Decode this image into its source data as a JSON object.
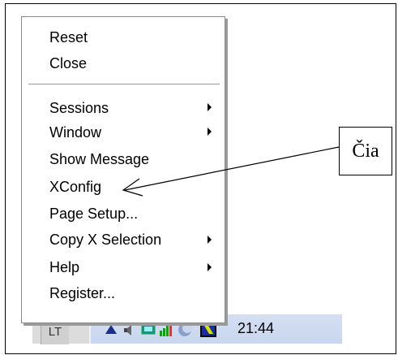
{
  "menu": {
    "items": [
      {
        "label": "Reset",
        "submenu": false
      },
      {
        "label": "Close",
        "submenu": false
      },
      {
        "label": "Sessions",
        "submenu": true
      },
      {
        "label": "Window",
        "submenu": true
      },
      {
        "label": "Show Message",
        "submenu": false
      },
      {
        "label": "XConfig",
        "submenu": false
      },
      {
        "label": "Page Setup...",
        "submenu": false
      },
      {
        "label": "Copy X Selection",
        "submenu": true
      },
      {
        "label": "Help",
        "submenu": true
      },
      {
        "label": "Register...",
        "submenu": false
      }
    ]
  },
  "taskbar": {
    "lang": "LT",
    "clock": "21:44"
  },
  "callout": {
    "text": "Čia"
  }
}
